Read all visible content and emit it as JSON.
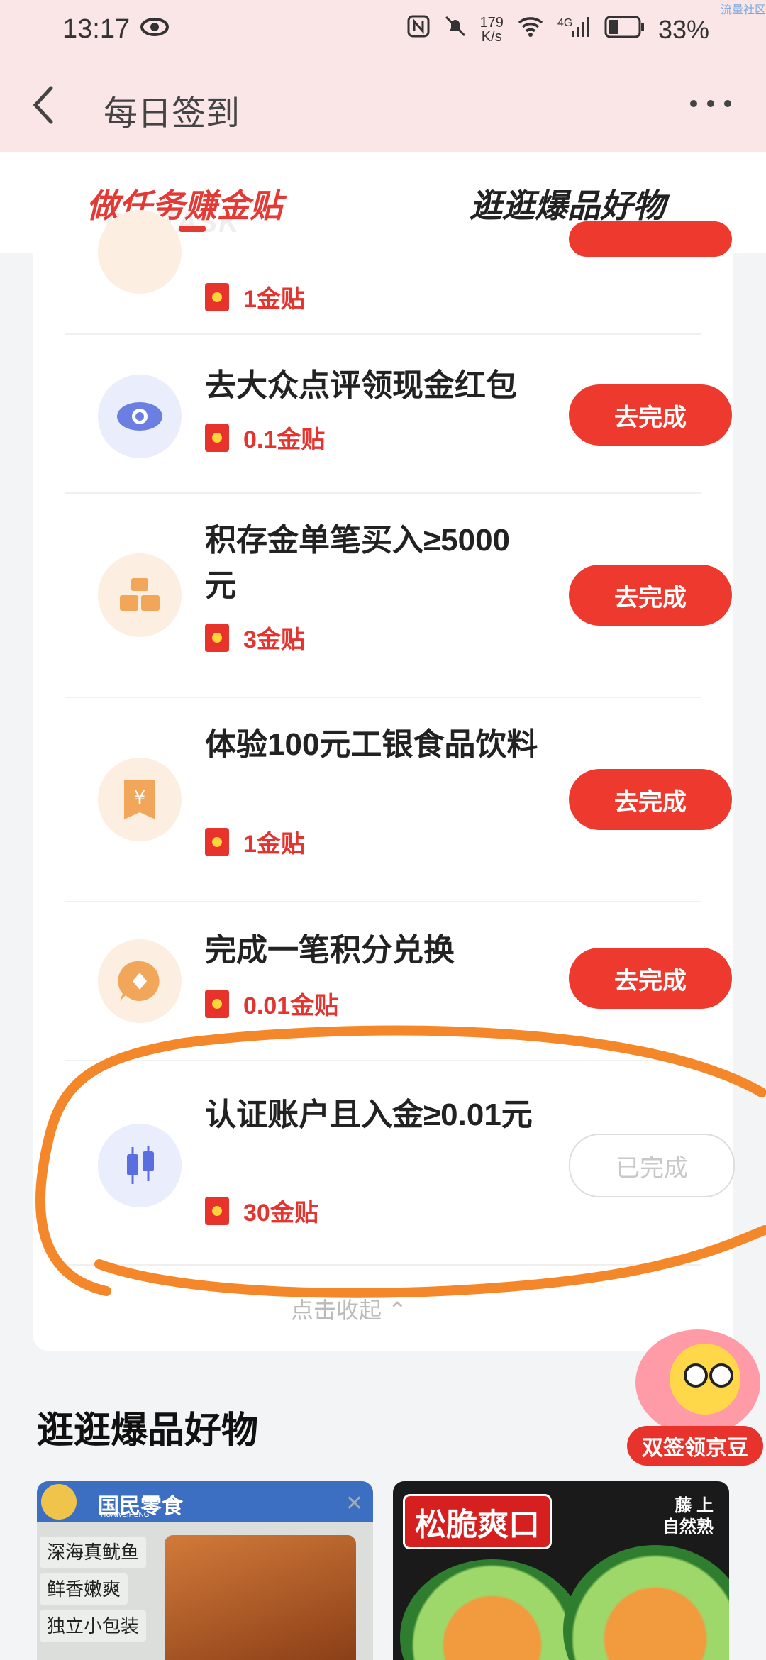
{
  "status_bar": {
    "time": "13:17",
    "net_speed_value": "179",
    "net_speed_unit": "K/s",
    "network_type": "4G",
    "battery_percent": "33%",
    "corner_text": "流量社区"
  },
  "app_bar": {
    "title": "每日签到"
  },
  "tabs": [
    {
      "label": "做任务赚金贴",
      "active": true,
      "watermark": "DO TASK"
    },
    {
      "label": "逛逛爆品好物",
      "active": false
    }
  ],
  "tasks": [
    {
      "name": "",
      "reward": "1金贴",
      "button": "",
      "icon": "gift-icon",
      "state": "partially-visible"
    },
    {
      "name": "去大众点评领现金红包",
      "reward": "0.1金贴",
      "button": "去完成",
      "icon": "eye-icon",
      "state": "todo"
    },
    {
      "name": "积存金单笔买入≥5000元",
      "reward": "3金贴",
      "button": "去完成",
      "icon": "gold-bars-icon",
      "state": "todo"
    },
    {
      "name": "体验100元工银食品饮料",
      "reward": "1金贴",
      "button": "去完成",
      "icon": "yuan-coupon-icon",
      "state": "todo"
    },
    {
      "name": "完成一笔积分兑换",
      "reward": "0.01金贴",
      "button": "去完成",
      "icon": "points-chat-icon",
      "state": "todo"
    },
    {
      "name": "认证账户且入金≥0.01元",
      "reward": "30金贴",
      "button": "已完成",
      "icon": "candlestick-icon",
      "state": "done"
    }
  ],
  "collapse_label": "点击收起 ⌃",
  "section": {
    "title": "逛逛爆品好物"
  },
  "floating_badge": {
    "label": "双签领京豆"
  },
  "products": [
    {
      "brand": "国民零食",
      "brand_sub": "HUAWEIHENG",
      "features": [
        "深海真鱿鱼",
        "鲜香嫩爽",
        "独立小包装"
      ]
    },
    {
      "tag": "松脆爽口",
      "sub_line1": "藤 上",
      "sub_line2": "自然熟"
    }
  ],
  "colors": {
    "brand_red": "#ee3a2e",
    "header_pink": "#fbe6e7",
    "annotation_orange": "#f5872b"
  }
}
